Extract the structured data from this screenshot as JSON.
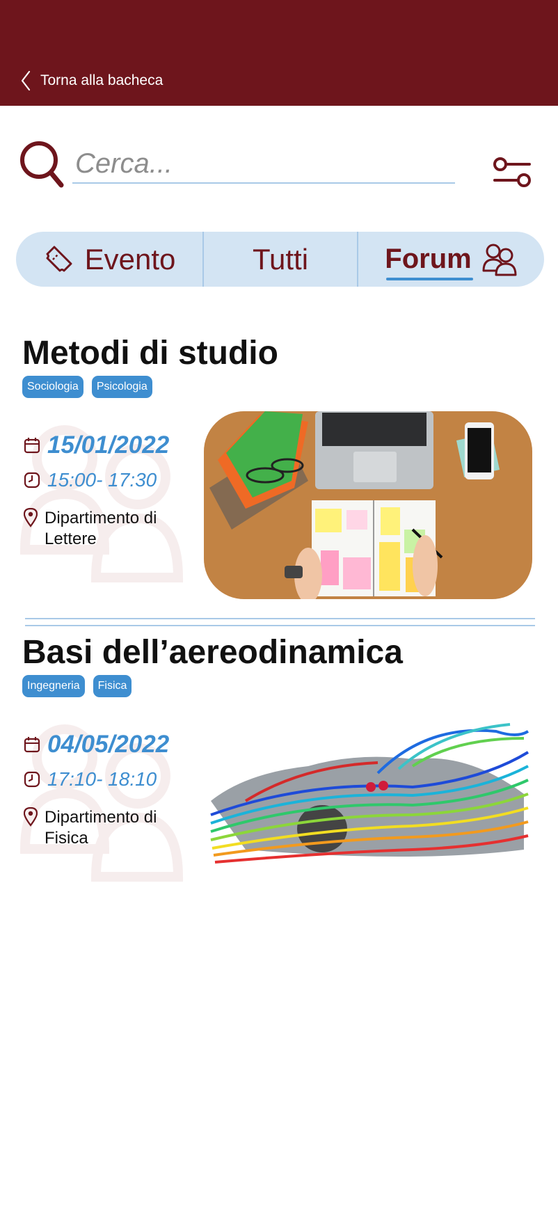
{
  "header": {
    "back_label": "Torna alla bacheca"
  },
  "search": {
    "placeholder": "Cerca..."
  },
  "tabs": [
    {
      "label": "Evento"
    },
    {
      "label": "Tutti"
    },
    {
      "label": "Forum",
      "active": true
    }
  ],
  "posts": [
    {
      "title": "Metodi di studio",
      "tags": [
        "Sociologia",
        "Psicologia"
      ],
      "date": "15/01/2022",
      "time": "15:00- 17:30",
      "location_line1": "Dipartimento di",
      "location_line2": "Lettere"
    },
    {
      "title": "Basi dell’aereodinamica",
      "tags": [
        "Ingegneria",
        "Fisica"
      ],
      "date": "04/05/2022",
      "time": "17:10- 18:10",
      "location_line1": "Dipartimento di",
      "location_line2": "Fisica"
    }
  ],
  "colors": {
    "primary": "#6e151c",
    "accent": "#3e8ed0",
    "light": "#d3e4f3"
  }
}
